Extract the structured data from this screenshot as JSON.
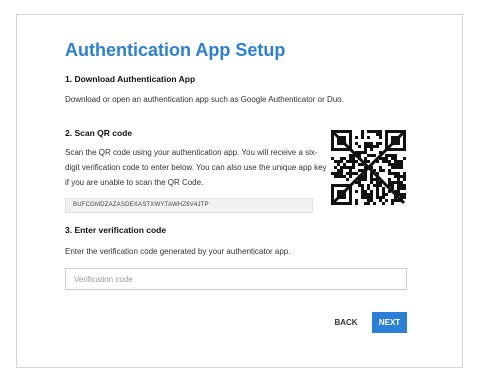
{
  "page": {
    "title": "Authentication App Setup"
  },
  "steps": [
    {
      "heading": "1. Download Authentication App",
      "text": "Download or open an authentication app such as Google Authenticator or Duo."
    },
    {
      "heading": "2. Scan QR code",
      "text": "Scan the QR code using your authentication app. You will receive a six-digit verification code to enter below. You can also use the unique app key if you are unable to scan the QR Code.",
      "app_key": "BUFCGMDZAZASDEXASTXWYTAWHZ6V4JTP"
    },
    {
      "heading": "3. Enter verification code",
      "text": "Enter the verification code generated by your authenticator app.",
      "input_placeholder": "Verification code",
      "input_value": ""
    }
  ],
  "buttons": {
    "back": "BACK",
    "next": "NEXT"
  },
  "colors": {
    "accent": "#2b7fd6",
    "qr": "#111111"
  },
  "icons": {
    "qr": "qr-code-icon",
    "cross": "cross-out-icon"
  }
}
